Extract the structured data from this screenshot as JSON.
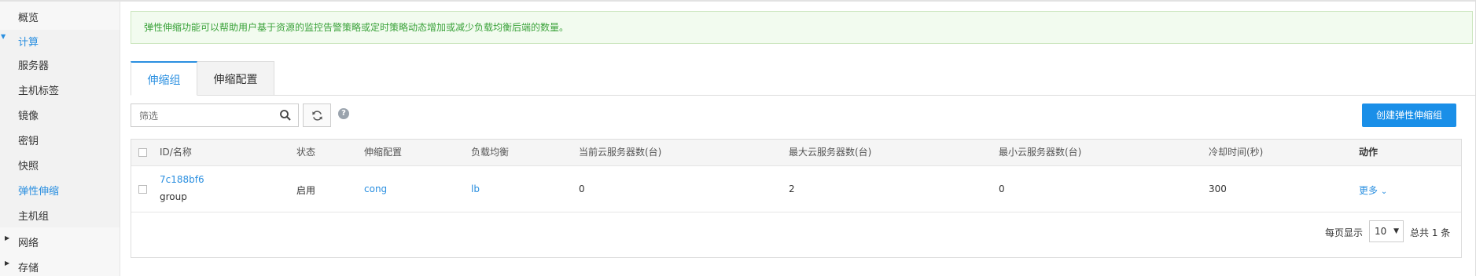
{
  "sidebar": {
    "items": [
      {
        "label": "概览"
      },
      {
        "label": "计算"
      },
      {
        "label": "服务器"
      },
      {
        "label": "主机标签"
      },
      {
        "label": "镜像"
      },
      {
        "label": "密钥"
      },
      {
        "label": "快照"
      },
      {
        "label": "弹性伸缩"
      },
      {
        "label": "主机组"
      },
      {
        "label": "网络"
      },
      {
        "label": "存储"
      }
    ]
  },
  "alert": {
    "text": "弹性伸缩功能可以帮助用户基于资源的监控告警策略或定时策略动态增加或减少负载均衡后端的数量。"
  },
  "tabs": [
    {
      "label": "伸缩组"
    },
    {
      "label": "伸缩配置"
    }
  ],
  "toolbar": {
    "search_placeholder": "筛选",
    "help_label": "?",
    "create_label": "创建弹性伸缩组"
  },
  "table": {
    "columns": [
      "ID/名称",
      "状态",
      "伸缩配置",
      "负载均衡",
      "当前云服务器数(台)",
      "最大云服务器数(台)",
      "最小云服务器数(台)",
      "冷却时间(秒)",
      "动作"
    ],
    "rows": [
      {
        "id": "7c188bf6",
        "name": "group",
        "status": "启用",
        "config": "cong",
        "lb": "lb",
        "current": "0",
        "max": "2",
        "min": "0",
        "cooldown": "300",
        "action": "更多"
      }
    ]
  },
  "pagination": {
    "per_page_label": "每页显示",
    "per_page_value": "10",
    "total_text": "总共 1 条"
  },
  "colors": {
    "accent": "#2a8fe0",
    "button": "#1a8fe8",
    "alert_text": "#3aa23a"
  }
}
